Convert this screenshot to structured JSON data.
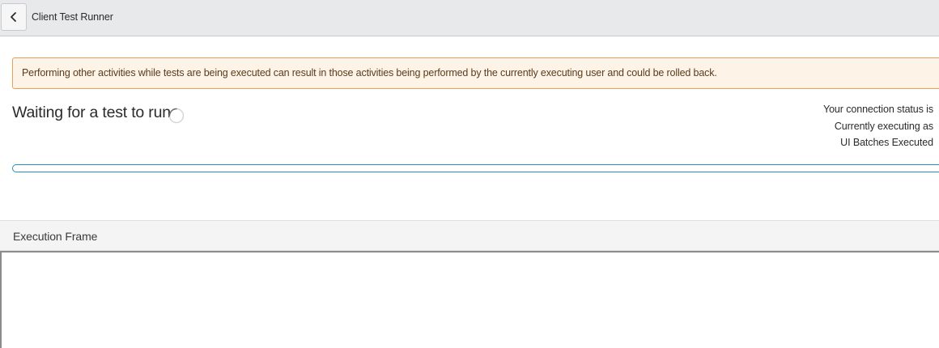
{
  "header": {
    "back_icon": "chevron-left-icon",
    "title": "Client Test Runner"
  },
  "alert": {
    "message": "Performing other activities while tests are being executed can result in those activities being performed by the currently executing user and could be rolled back.",
    "colors": {
      "background": "#fdf3e6",
      "border": "#e4a05a"
    }
  },
  "runner": {
    "status": "Waiting for a test to run",
    "spinner_icon": "loading-spinner-icon",
    "connection_status_label": "Your connection status is",
    "executing_as_label": "Currently executing as",
    "ui_batches_label": "UI Batches Executed",
    "progress": 0,
    "progress_color": "#2b8cbf"
  },
  "frame": {
    "title": "Execution Frame"
  }
}
